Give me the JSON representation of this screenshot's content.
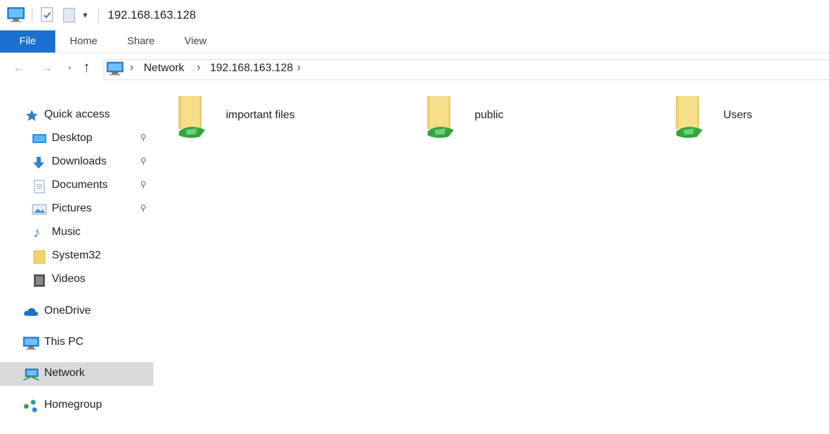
{
  "window": {
    "title": "192.168.163.128"
  },
  "ribbon": {
    "tabs": [
      "File",
      "Home",
      "Share",
      "View"
    ]
  },
  "breadcrumb": [
    "Network",
    "192.168.163.128"
  ],
  "sidebar": {
    "quick_access": "Quick access",
    "pinned": [
      "Desktop",
      "Downloads",
      "Documents",
      "Pictures"
    ],
    "others": [
      "Music",
      "System32",
      "Videos"
    ],
    "onedrive": "OneDrive",
    "this_pc": "This PC",
    "network": "Network",
    "homegroup": "Homegroup"
  },
  "folders": [
    "important files",
    "public",
    "Users"
  ],
  "colors": {
    "accent": "#1a6fd0",
    "folder": "#f2d46f",
    "share": "#2fa73d",
    "selected": "#d9d9d9"
  }
}
